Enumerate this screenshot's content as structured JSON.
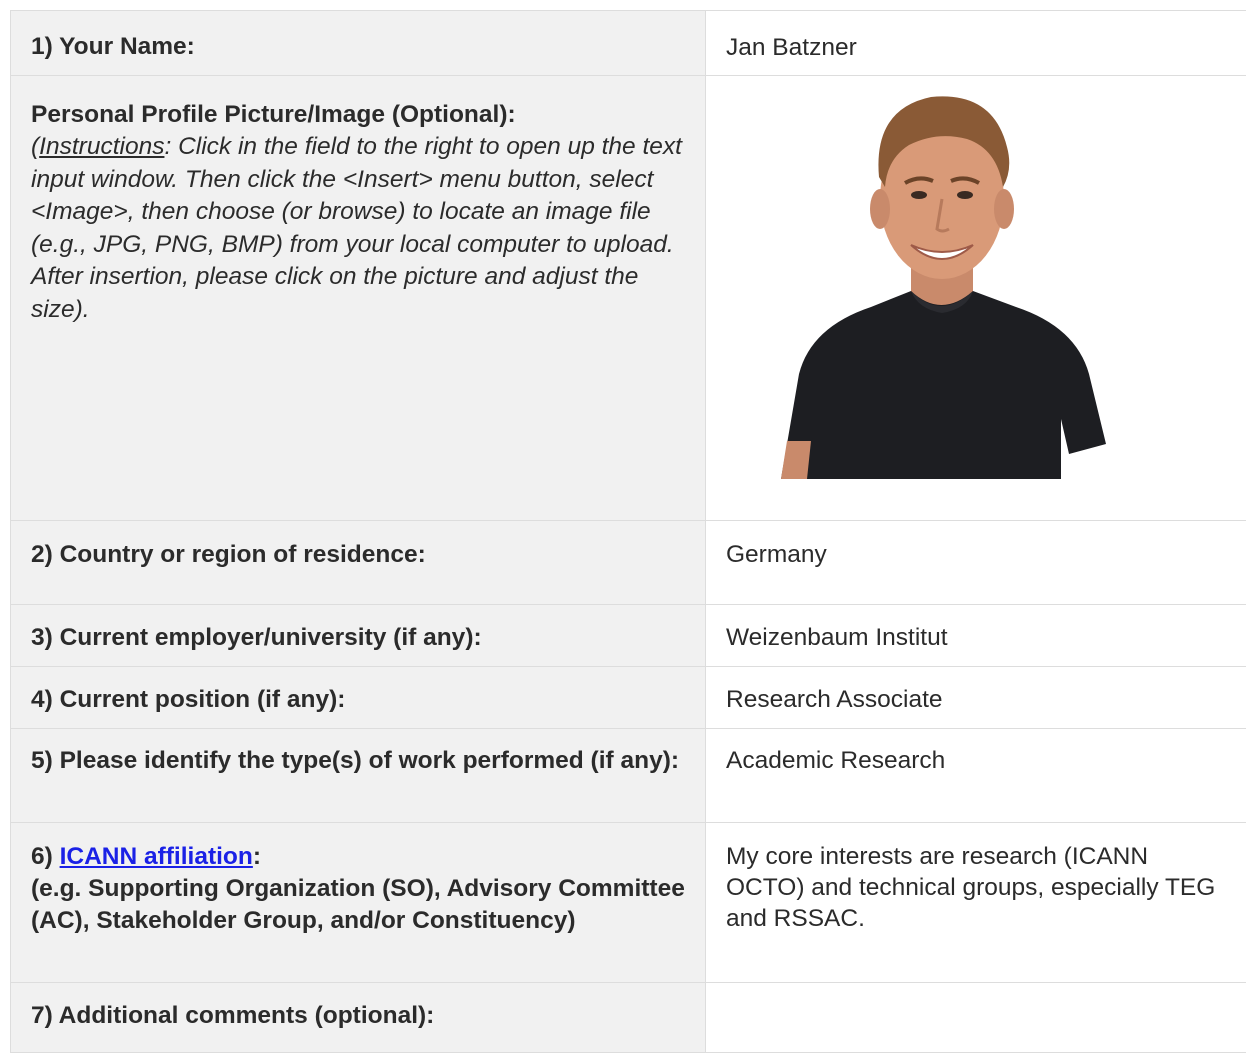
{
  "rows": {
    "name": {
      "label": "1) Your Name:",
      "value": "Jan Batzner"
    },
    "photo": {
      "label": "Personal Profile Picture/Image (Optional):",
      "instructions_open": "(",
      "instructions_word": "Instructions",
      "instructions_text": ": Click in the field to the right to open up the text input window. Then click the <Insert> menu button, select <Image>, then choose (or browse) to locate an image file (e.g., JPG, PNG, BMP) from your local computer to upload. After insertion, please click on the picture and adjust the size)."
    },
    "country": {
      "label": "2) Country or region of residence:",
      "value": "Germany"
    },
    "employer": {
      "label": "3) Current employer/university (if any):",
      "value": "Weizenbaum Institut"
    },
    "position": {
      "label": "4) Current position (if any):",
      "value": "Research Associate"
    },
    "work": {
      "label": "5) Please identify the type(s) of work performed (if any):",
      "value": "Academic Research"
    },
    "affiliation": {
      "label_prefix": "6) ",
      "label_link": "ICANN affiliation",
      "label_colon": ":",
      "label_detail": "(e.g. Supporting Organization (SO), Advisory Committee (AC), Stakeholder Group, and/or Constituency)",
      "value": "My core interests are research (ICANN OCTO) and technical groups, especially TEG and RSSAC."
    },
    "comments": {
      "label": "7) Additional comments (optional):",
      "value": ""
    }
  },
  "colors": {
    "label_bg": "#f1f1f1",
    "border": "#dddddd",
    "text": "#2b2b2b",
    "link": "#1a21e6"
  }
}
